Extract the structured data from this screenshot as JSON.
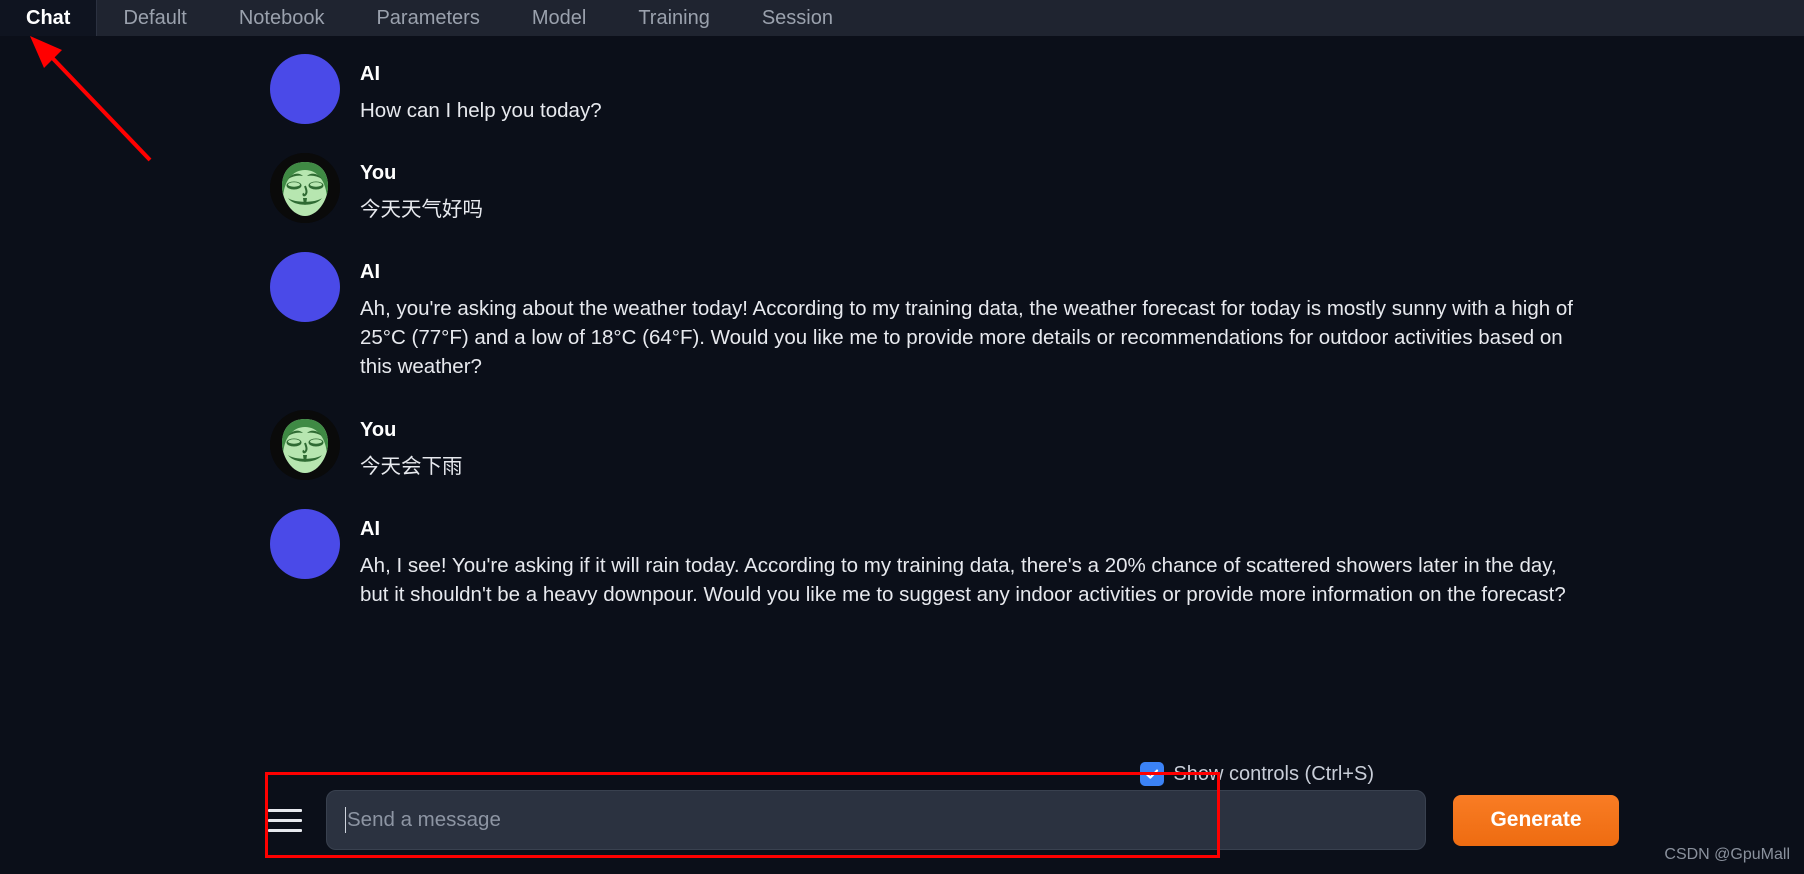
{
  "window": {
    "background": "#0b0f19",
    "accent_orange": "#ee6c11",
    "accent_blue": "#3b82f6",
    "annotation_color": "#ff0000"
  },
  "tabs": [
    {
      "label": "Chat",
      "active": true
    },
    {
      "label": "Default",
      "active": false
    },
    {
      "label": "Notebook",
      "active": false
    },
    {
      "label": "Parameters",
      "active": false
    },
    {
      "label": "Model",
      "active": false
    },
    {
      "label": "Training",
      "active": false
    },
    {
      "label": "Session",
      "active": false
    }
  ],
  "chat": {
    "messages": [
      {
        "role": "ai",
        "name": "AI",
        "avatar": "ai-avatar",
        "text": "How can I help you today?"
      },
      {
        "role": "user",
        "name": "You",
        "avatar": "anonymous-mask-avatar",
        "text": "今天天气好吗"
      },
      {
        "role": "ai",
        "name": "AI",
        "avatar": "ai-avatar",
        "text": "Ah, you're asking about the weather today! According to my training data, the weather forecast for today is mostly sunny with a high of 25°C (77°F) and a low of 18°C (64°F). Would you like me to provide more details or recommendations for outdoor activities based on this weather?"
      },
      {
        "role": "user",
        "name": "You",
        "avatar": "anonymous-mask-avatar",
        "text": "今天会下雨"
      },
      {
        "role": "ai",
        "name": "AI",
        "avatar": "ai-avatar",
        "text": "Ah, I see! You're asking if it will rain today. According to my training data, there's a 20% chance of scattered showers later in the day, but it shouldn't be a heavy downpour. Would you like me to suggest any indoor activities or provide more information on the forecast?"
      }
    ]
  },
  "controls": {
    "show_controls_label": "Show controls (Ctrl+S)",
    "show_controls_checked": true,
    "checkbox_icon": "checkmark-icon",
    "menu_icon": "hamburger-menu-icon",
    "message_input": {
      "value": "",
      "placeholder": "Send a message"
    },
    "generate_label": "Generate"
  },
  "watermark": {
    "text": "CSDN @GpuMall"
  }
}
